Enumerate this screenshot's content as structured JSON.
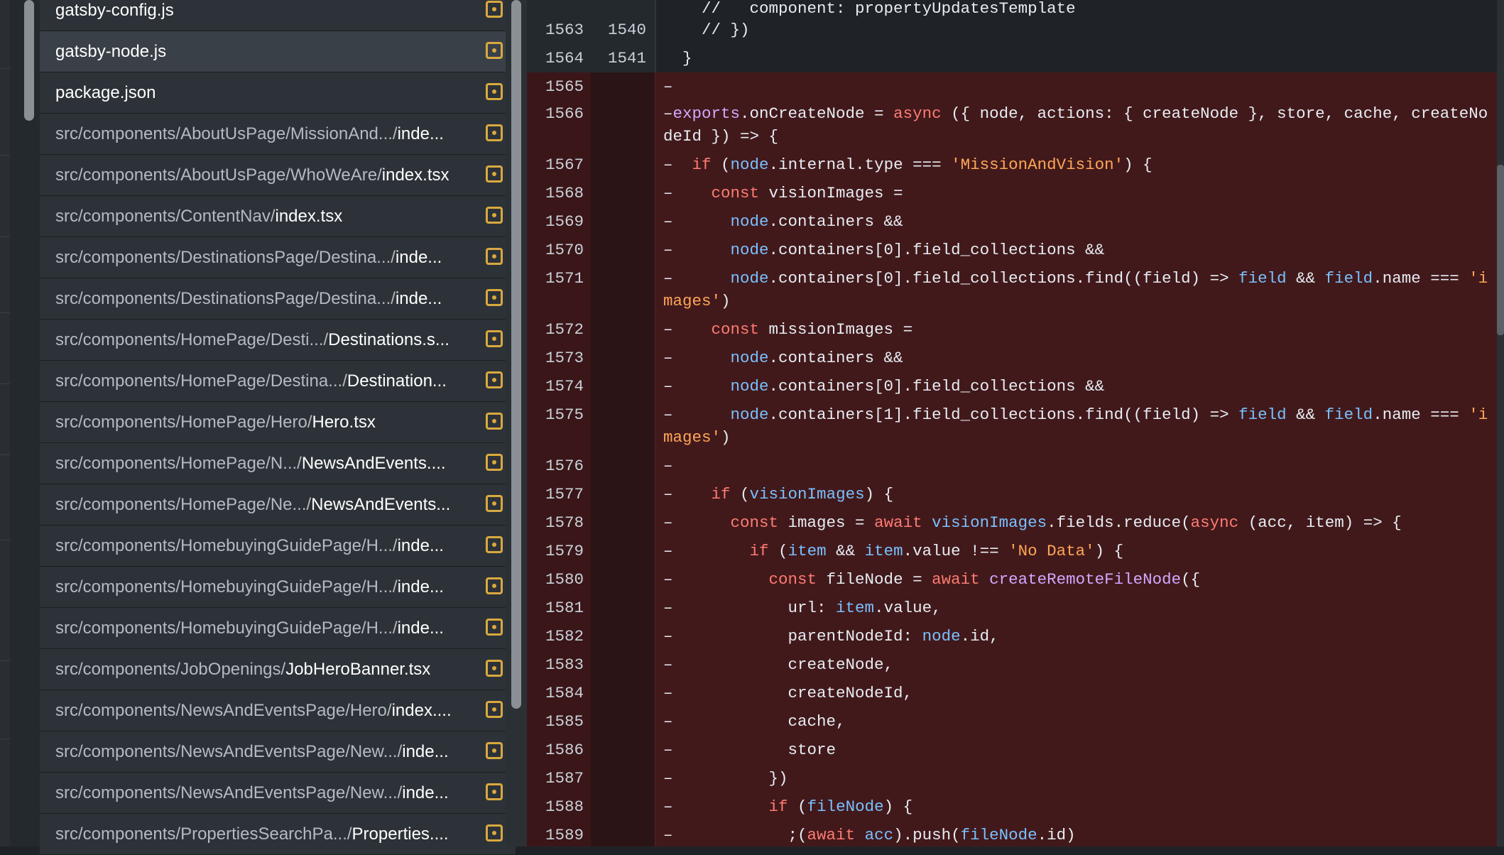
{
  "file_list": {
    "items": [
      {
        "dir": "",
        "name": "gatsby-config.js",
        "selected": false
      },
      {
        "dir": "",
        "name": "gatsby-node.js",
        "selected": true
      },
      {
        "dir": "",
        "name": "package.json",
        "selected": false
      },
      {
        "dir": "src/components/AboutUsPage/MissionAnd.../",
        "name": "inde...",
        "selected": false
      },
      {
        "dir": "src/components/AboutUsPage/WhoWeAre/",
        "name": "index.tsx",
        "selected": false
      },
      {
        "dir": "src/components/ContentNav/",
        "name": "index.tsx",
        "selected": false
      },
      {
        "dir": "src/components/DestinationsPage/Destina.../",
        "name": "inde...",
        "selected": false
      },
      {
        "dir": "src/components/DestinationsPage/Destina.../",
        "name": "inde...",
        "selected": false
      },
      {
        "dir": "src/components/HomePage/Desti.../",
        "name": "Destinations.s...",
        "selected": false
      },
      {
        "dir": "src/components/HomePage/Destina.../",
        "name": "Destination...",
        "selected": false
      },
      {
        "dir": "src/components/HomePage/Hero/",
        "name": "Hero.tsx",
        "selected": false
      },
      {
        "dir": "src/components/HomePage/N.../",
        "name": "NewsAndEvents....",
        "selected": false
      },
      {
        "dir": "src/components/HomePage/Ne.../",
        "name": "NewsAndEvents...",
        "selected": false
      },
      {
        "dir": "src/components/HomebuyingGuidePage/H.../",
        "name": "inde...",
        "selected": false
      },
      {
        "dir": "src/components/HomebuyingGuidePage/H.../",
        "name": "inde...",
        "selected": false
      },
      {
        "dir": "src/components/HomebuyingGuidePage/H.../",
        "name": "inde...",
        "selected": false
      },
      {
        "dir": "src/components/JobOpenings/",
        "name": "JobHeroBanner.tsx",
        "selected": false
      },
      {
        "dir": "src/components/NewsAndEventsPage/Hero/",
        "name": "index....",
        "selected": false
      },
      {
        "dir": "src/components/NewsAndEventsPage/New.../",
        "name": "inde...",
        "selected": false
      },
      {
        "dir": "src/components/NewsAndEventsPage/New.../",
        "name": "inde...",
        "selected": false
      },
      {
        "dir": "src/components/PropertiesSearchPa.../",
        "name": "Properties....",
        "selected": false
      }
    ],
    "file_icon": "file-modified-icon",
    "icon_color": "#d9a93f"
  },
  "diff": {
    "colors": {
      "deleted_bg": "#42191b",
      "keyword": "#ff7b72",
      "entity": "#d2a8ff",
      "variable": "#79c0ff",
      "string": "#ffa657"
    },
    "lines": [
      {
        "old": "",
        "new": "",
        "type": "ctx",
        "tokens": [
          [
            "t-pl",
            "    //   component: propertyUpdatesTemplate"
          ]
        ]
      },
      {
        "old": "1563",
        "new": "1540",
        "type": "ctx",
        "tokens": [
          [
            "t-pl",
            "    // })"
          ]
        ]
      },
      {
        "old": "1564",
        "new": "1541",
        "type": "ctx",
        "tokens": [
          [
            "t-pl",
            "  }"
          ]
        ]
      },
      {
        "old": "1565",
        "new": "",
        "type": "del",
        "tokens": [
          [
            "t-pl",
            "–"
          ]
        ]
      },
      {
        "old": "1566",
        "new": "",
        "type": "del",
        "tokens": [
          [
            "t-pl",
            "–"
          ],
          [
            "t-ent",
            "exports"
          ],
          [
            "t-pl",
            ".onCreateNode = "
          ],
          [
            "t-kw",
            "async"
          ],
          [
            "t-pl",
            " ({ node, actions: { createNode }, store, cache, createNodeId }) => {"
          ]
        ]
      },
      {
        "old": "1567",
        "new": "",
        "type": "del",
        "tokens": [
          [
            "t-pl",
            "–  "
          ],
          [
            "t-kw",
            "if"
          ],
          [
            "t-pl",
            " ("
          ],
          [
            "t-var",
            "node"
          ],
          [
            "t-pl",
            ".internal.type === "
          ],
          [
            "t-str",
            "'MissionAndVision'"
          ],
          [
            "t-pl",
            ") {"
          ]
        ]
      },
      {
        "old": "1568",
        "new": "",
        "type": "del",
        "tokens": [
          [
            "t-pl",
            "–    "
          ],
          [
            "t-kw",
            "const"
          ],
          [
            "t-pl",
            " visionImages ="
          ]
        ]
      },
      {
        "old": "1569",
        "new": "",
        "type": "del",
        "tokens": [
          [
            "t-pl",
            "–      "
          ],
          [
            "t-var",
            "node"
          ],
          [
            "t-pl",
            ".containers &&"
          ]
        ]
      },
      {
        "old": "1570",
        "new": "",
        "type": "del",
        "tokens": [
          [
            "t-pl",
            "–      "
          ],
          [
            "t-var",
            "node"
          ],
          [
            "t-pl",
            ".containers[0].field_collections &&"
          ]
        ]
      },
      {
        "old": "1571",
        "new": "",
        "type": "del",
        "tokens": [
          [
            "t-pl",
            "–      "
          ],
          [
            "t-var",
            "node"
          ],
          [
            "t-pl",
            ".containers[0].field_collections.find((field) => "
          ],
          [
            "t-var",
            "field"
          ],
          [
            "t-pl",
            " && "
          ],
          [
            "t-var",
            "field"
          ],
          [
            "t-pl",
            ".name === "
          ],
          [
            "t-str",
            "'images'"
          ],
          [
            "t-pl",
            ")"
          ]
        ]
      },
      {
        "old": "1572",
        "new": "",
        "type": "del",
        "tokens": [
          [
            "t-pl",
            "–    "
          ],
          [
            "t-kw",
            "const"
          ],
          [
            "t-pl",
            " missionImages ="
          ]
        ]
      },
      {
        "old": "1573",
        "new": "",
        "type": "del",
        "tokens": [
          [
            "t-pl",
            "–      "
          ],
          [
            "t-var",
            "node"
          ],
          [
            "t-pl",
            ".containers &&"
          ]
        ]
      },
      {
        "old": "1574",
        "new": "",
        "type": "del",
        "tokens": [
          [
            "t-pl",
            "–      "
          ],
          [
            "t-var",
            "node"
          ],
          [
            "t-pl",
            ".containers[0].field_collections &&"
          ]
        ]
      },
      {
        "old": "1575",
        "new": "",
        "type": "del",
        "tokens": [
          [
            "t-pl",
            "–      "
          ],
          [
            "t-var",
            "node"
          ],
          [
            "t-pl",
            ".containers[1].field_collections.find((field) => "
          ],
          [
            "t-var",
            "field"
          ],
          [
            "t-pl",
            " && "
          ],
          [
            "t-var",
            "field"
          ],
          [
            "t-pl",
            ".name === "
          ],
          [
            "t-str",
            "'images'"
          ],
          [
            "t-pl",
            ")"
          ]
        ]
      },
      {
        "old": "1576",
        "new": "",
        "type": "del",
        "tokens": [
          [
            "t-pl",
            "–"
          ]
        ]
      },
      {
        "old": "1577",
        "new": "",
        "type": "del",
        "tokens": [
          [
            "t-pl",
            "–    "
          ],
          [
            "t-kw",
            "if"
          ],
          [
            "t-pl",
            " ("
          ],
          [
            "t-var",
            "visionImages"
          ],
          [
            "t-pl",
            ") {"
          ]
        ]
      },
      {
        "old": "1578",
        "new": "",
        "type": "del",
        "tokens": [
          [
            "t-pl",
            "–      "
          ],
          [
            "t-kw",
            "const"
          ],
          [
            "t-pl",
            " images = "
          ],
          [
            "t-kw",
            "await"
          ],
          [
            "t-pl",
            " "
          ],
          [
            "t-var",
            "visionImages"
          ],
          [
            "t-pl",
            ".fields.reduce("
          ],
          [
            "t-kw",
            "async"
          ],
          [
            "t-pl",
            " (acc, item) => {"
          ]
        ]
      },
      {
        "old": "1579",
        "new": "",
        "type": "del",
        "tokens": [
          [
            "t-pl",
            "–        "
          ],
          [
            "t-kw",
            "if"
          ],
          [
            "t-pl",
            " ("
          ],
          [
            "t-var",
            "item"
          ],
          [
            "t-pl",
            " && "
          ],
          [
            "t-var",
            "item"
          ],
          [
            "t-pl",
            ".value !== "
          ],
          [
            "t-str",
            "'No Data'"
          ],
          [
            "t-pl",
            ") {"
          ]
        ]
      },
      {
        "old": "1580",
        "new": "",
        "type": "del",
        "tokens": [
          [
            "t-pl",
            "–          "
          ],
          [
            "t-kw",
            "const"
          ],
          [
            "t-pl",
            " fileNode = "
          ],
          [
            "t-kw",
            "await"
          ],
          [
            "t-pl",
            " "
          ],
          [
            "t-ent",
            "createRemoteFileNode"
          ],
          [
            "t-pl",
            "({"
          ]
        ]
      },
      {
        "old": "1581",
        "new": "",
        "type": "del",
        "tokens": [
          [
            "t-pl",
            "–            url: "
          ],
          [
            "t-var",
            "item"
          ],
          [
            "t-pl",
            ".value,"
          ]
        ]
      },
      {
        "old": "1582",
        "new": "",
        "type": "del",
        "tokens": [
          [
            "t-pl",
            "–            parentNodeId: "
          ],
          [
            "t-var",
            "node"
          ],
          [
            "t-pl",
            ".id,"
          ]
        ]
      },
      {
        "old": "1583",
        "new": "",
        "type": "del",
        "tokens": [
          [
            "t-pl",
            "–            createNode,"
          ]
        ]
      },
      {
        "old": "1584",
        "new": "",
        "type": "del",
        "tokens": [
          [
            "t-pl",
            "–            createNodeId,"
          ]
        ]
      },
      {
        "old": "1585",
        "new": "",
        "type": "del",
        "tokens": [
          [
            "t-pl",
            "–            cache,"
          ]
        ]
      },
      {
        "old": "1586",
        "new": "",
        "type": "del",
        "tokens": [
          [
            "t-pl",
            "–            store"
          ]
        ]
      },
      {
        "old": "1587",
        "new": "",
        "type": "del",
        "tokens": [
          [
            "t-pl",
            "–          })"
          ]
        ]
      },
      {
        "old": "1588",
        "new": "",
        "type": "del",
        "tokens": [
          [
            "t-pl",
            "–          "
          ],
          [
            "t-kw",
            "if"
          ],
          [
            "t-pl",
            " ("
          ],
          [
            "t-var",
            "fileNode"
          ],
          [
            "t-pl",
            ") {"
          ]
        ]
      },
      {
        "old": "1589",
        "new": "",
        "type": "del",
        "tokens": [
          [
            "t-pl",
            "–            ;("
          ],
          [
            "t-kw",
            "await"
          ],
          [
            "t-pl",
            " "
          ],
          [
            "t-var",
            "acc"
          ],
          [
            "t-pl",
            ").push("
          ],
          [
            "t-var",
            "fileNode"
          ],
          [
            "t-pl",
            ".id)"
          ]
        ]
      }
    ]
  }
}
